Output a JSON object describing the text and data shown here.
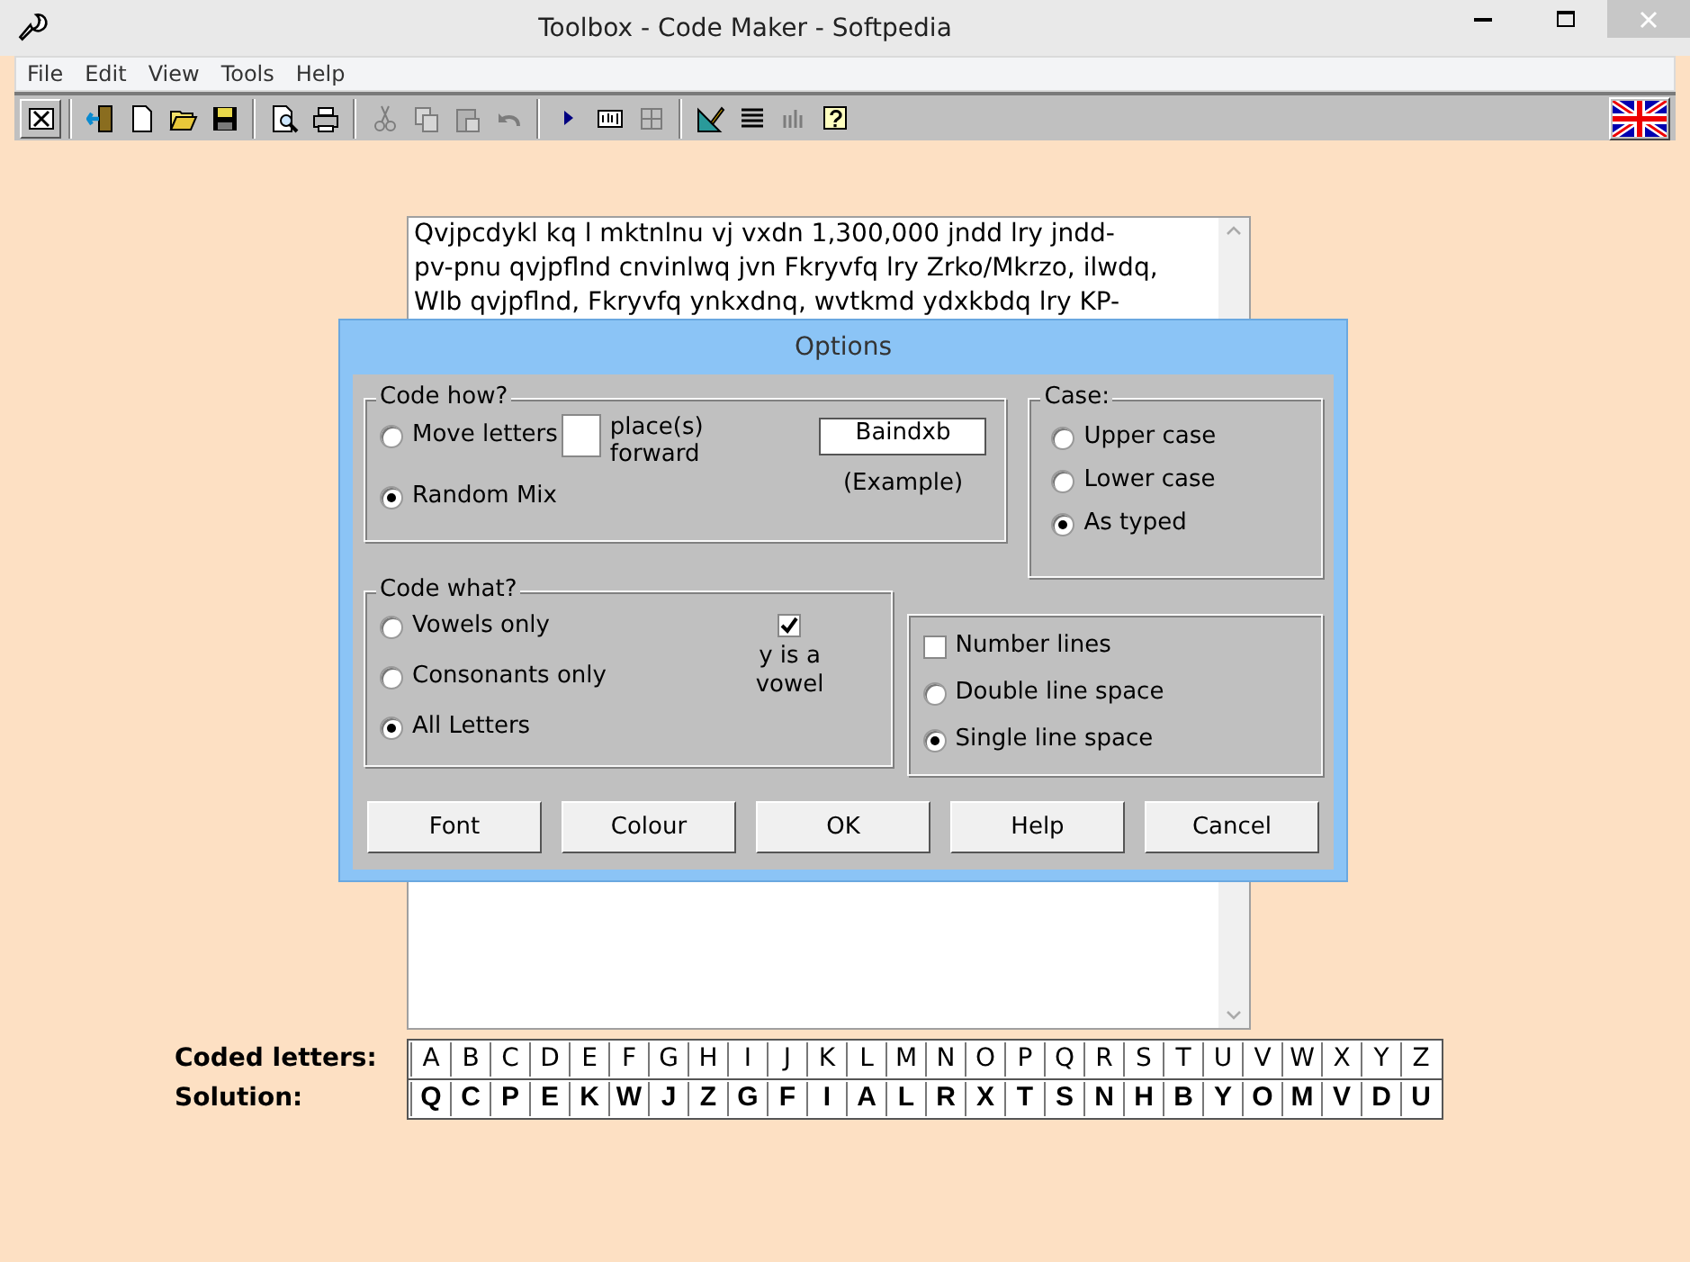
{
  "window": {
    "title": "Toolbox - Code Maker - Softpedia"
  },
  "menu": [
    "File",
    "Edit",
    "View",
    "Tools",
    "Help"
  ],
  "toolbar": [
    {
      "disabled": false
    },
    {
      "disabled": false
    },
    {
      "disabled": false
    },
    {
      "disabled": false
    },
    {
      "disabled": false
    },
    {
      "disabled": false
    },
    {
      "disabled": false
    },
    {
      "disabled": true
    },
    {
      "disabled": true
    },
    {
      "disabled": true
    },
    {
      "disabled": true
    },
    {
      "disabled": false
    },
    {
      "disabled": false
    },
    {
      "disabled": true
    },
    {
      "disabled": false
    },
    {
      "disabled": false
    },
    {
      "disabled": true
    },
    {
      "disabled": false
    }
  ],
  "document": {
    "lines": [
      "Qvjpcdykl kq l mktnlnu vj vxdn 1,300,000 jndd lry jndd-",
      "pv-pnu qvjpflnd cnvinlwq jvn Fkryvfq lry Zrko/Mkrzo, ilwdq,",
      "Wlb qvjpflnd, Fkryvfq ynkxdnq, wvtkmd ydxkbdq lry KP-"
    ]
  },
  "dialog": {
    "title": "Options",
    "code_how": {
      "title": "Code how?",
      "options": [
        {
          "label": "Move letters",
          "selected": false,
          "kind": "shift"
        },
        {
          "label": "Random Mix",
          "selected": true,
          "kind": "plain"
        }
      ],
      "places_label": "place(s) forward",
      "example": "Baindxb",
      "example_caption": "(Example)"
    },
    "case": {
      "title": "Case:",
      "options": [
        {
          "label": "Upper case",
          "selected": false
        },
        {
          "label": "Lower case",
          "selected": false
        },
        {
          "label": "As typed",
          "selected": true
        }
      ]
    },
    "code_what": {
      "title": "Code what?",
      "options": [
        {
          "label": "Vowels only",
          "selected": false
        },
        {
          "label": "Consonants only",
          "selected": false
        },
        {
          "label": "All Letters",
          "selected": true
        }
      ],
      "y_vowel": {
        "label": "y is a vowel",
        "checked": true
      }
    },
    "layout": {
      "number_lines": {
        "label": "Number lines",
        "checked": false
      },
      "options": [
        {
          "label": "Double line space",
          "selected": false
        },
        {
          "label": "Single line space",
          "selected": true
        }
      ]
    },
    "buttons": [
      "Font",
      "Colour",
      "OK",
      "Help",
      "Cancel"
    ]
  },
  "key": {
    "coded_label": "Coded letters:",
    "coded": [
      "A",
      "B",
      "C",
      "D",
      "E",
      "F",
      "G",
      "H",
      "I",
      "J",
      "K",
      "L",
      "M",
      "N",
      "O",
      "P",
      "Q",
      "R",
      "S",
      "T",
      "U",
      "V",
      "W",
      "X",
      "Y",
      "Z"
    ],
    "solution_label": "Solution:",
    "solution": [
      "Q",
      "C",
      "P",
      "E",
      "K",
      "W",
      "J",
      "Z",
      "G",
      "F",
      "I",
      "A",
      "L",
      "R",
      "X",
      "T",
      "S",
      "N",
      "H",
      "B",
      "Y",
      "O",
      "M",
      "V",
      "D",
      "U"
    ]
  }
}
